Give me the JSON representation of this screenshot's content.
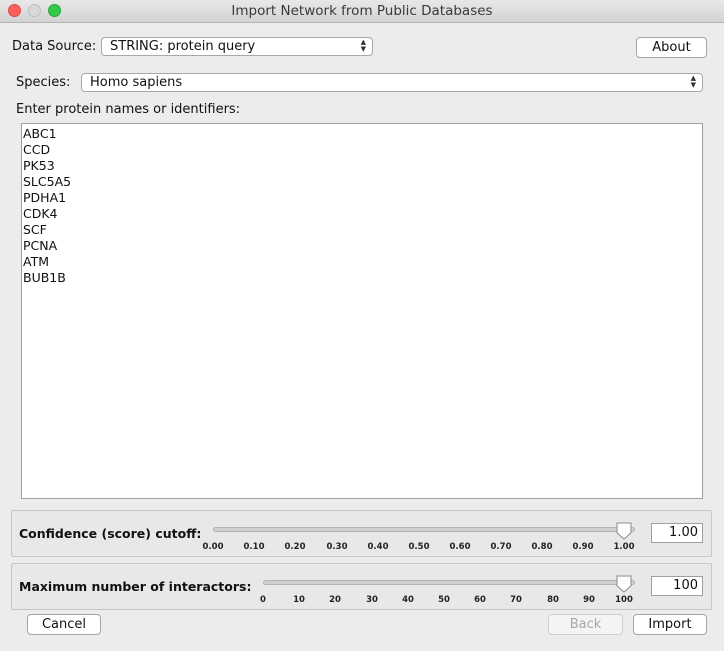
{
  "window": {
    "title": "Import Network from Public Databases"
  },
  "data_source": {
    "label": "Data Source:",
    "value": "STRING: protein query"
  },
  "about_button": "About",
  "species": {
    "label": "Species:",
    "value": "Homo sapiens"
  },
  "proteins": {
    "label": "Enter protein names or identifiers:",
    "lines": [
      "ABC1",
      "CCD",
      "PK53",
      "SLC5A5",
      "PDHA1",
      "CDK4",
      "SCF",
      "PCNA",
      "ATM",
      "BUB1B"
    ]
  },
  "confidence": {
    "label": "Confidence (score) cutoff:",
    "ticks": [
      "0.00",
      "0.10",
      "0.20",
      "0.30",
      "0.40",
      "0.50",
      "0.60",
      "0.70",
      "0.80",
      "0.90",
      "1.00"
    ],
    "value": "1.00",
    "slider_fraction": 1.0
  },
  "interactors": {
    "label": "Maximum number of interactors:",
    "ticks": [
      "0",
      "10",
      "20",
      "30",
      "40",
      "50",
      "60",
      "70",
      "80",
      "90",
      "100"
    ],
    "value": "100",
    "slider_fraction": 1.0
  },
  "buttons": {
    "cancel": "Cancel",
    "back": "Back",
    "import": "Import"
  }
}
